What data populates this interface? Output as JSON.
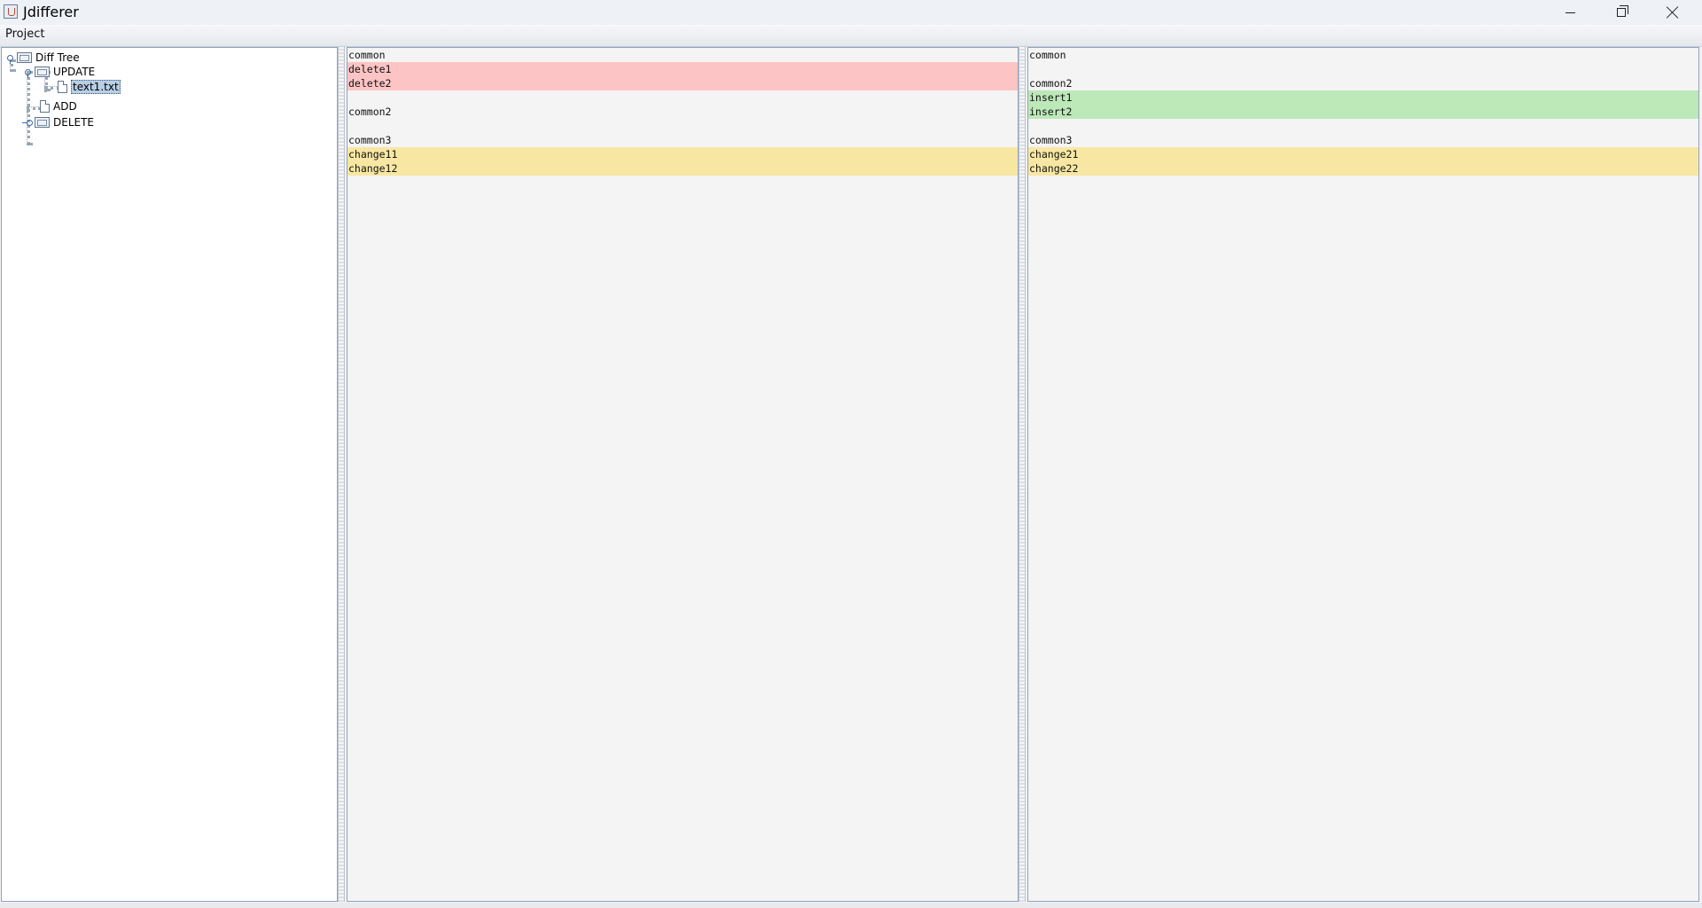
{
  "window": {
    "title": "Jdifferer"
  },
  "menu": {
    "items": [
      "Project"
    ]
  },
  "tree": {
    "root": "Diff Tree",
    "update": "UPDATE",
    "update_file": "text1.txt",
    "add": "ADD",
    "delete": "DELETE"
  },
  "left_lines": [
    {
      "text": "common",
      "status": "common"
    },
    {
      "text": "delete1",
      "status": "delete"
    },
    {
      "text": "delete2",
      "status": "delete"
    },
    {
      "text": "",
      "status": "blank"
    },
    {
      "text": "common2",
      "status": "common"
    },
    {
      "text": "",
      "status": "blank"
    },
    {
      "text": "common3",
      "status": "common"
    },
    {
      "text": "change11",
      "status": "change"
    },
    {
      "text": "change12",
      "status": "change"
    }
  ],
  "right_lines": [
    {
      "text": "common",
      "status": "common"
    },
    {
      "text": "",
      "status": "blank"
    },
    {
      "text": "common2",
      "status": "common"
    },
    {
      "text": "insert1",
      "status": "insert"
    },
    {
      "text": "insert2",
      "status": "insert"
    },
    {
      "text": "",
      "status": "blank"
    },
    {
      "text": "common3",
      "status": "common"
    },
    {
      "text": "change21",
      "status": "change"
    },
    {
      "text": "change22",
      "status": "change"
    }
  ],
  "colors": {
    "delete": "#fcc4c4",
    "insert": "#bde8b8",
    "change": "#f8e7a2"
  }
}
